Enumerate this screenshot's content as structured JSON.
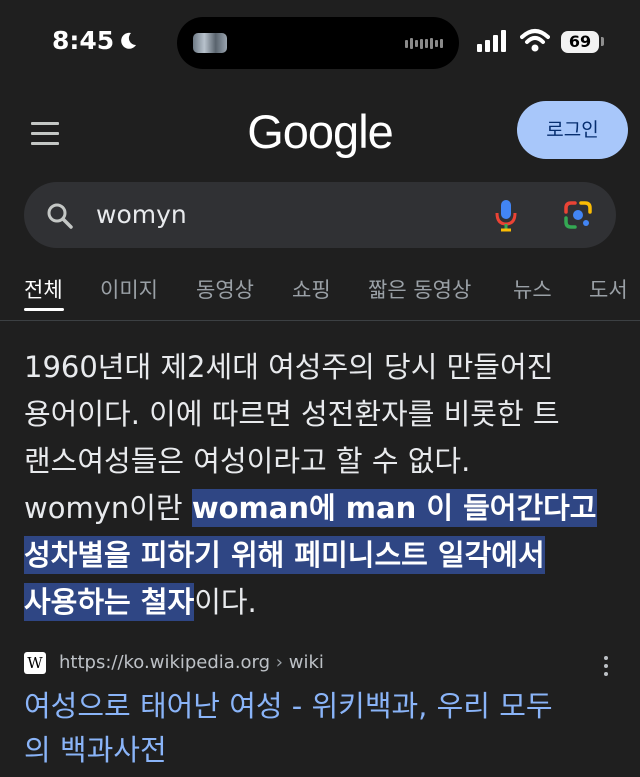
{
  "status_bar": {
    "time": "8:45",
    "battery": "69"
  },
  "header": {
    "logo": "Google",
    "login_label": "로그인"
  },
  "search": {
    "query": "womyn"
  },
  "tabs": [
    "전체",
    "이미지",
    "동영상",
    "쇼핑",
    "짧은 동영상",
    "뉴스",
    "도서"
  ],
  "snippet": {
    "line1": "1960년대 제2세대 여성주의 당시 만들어진",
    "line2": "용어이다. 이에 따르면 성전환자를 비롯한 트",
    "line3": "랜스여성들은 여성이라고 할 수 없다.",
    "line4_plain": "womyn이란 ",
    "line4_hl_bold1": "woman",
    "line4_hl_mid": "에 ",
    "line4_hl_bold2": "man",
    "line4_hl_rest": " 이 들어간다고",
    "line5_hl": "성차별을 피하기 위해 페미니스트 일각에서",
    "line6_hl": "사용하는 철자",
    "line6_plain": "이다."
  },
  "result": {
    "favicon": "W",
    "url": "https://ko.wikipedia.org",
    "path": "wiki",
    "title_line1": "여성으로 태어난 여성 - 위키백과, 우리 모두",
    "title_line2": "의 백과사전"
  },
  "colors": {
    "background": "#1f1f1f",
    "link": "#8ab4f8",
    "highlight": "#2f4684",
    "login": "#a8c7fa"
  }
}
